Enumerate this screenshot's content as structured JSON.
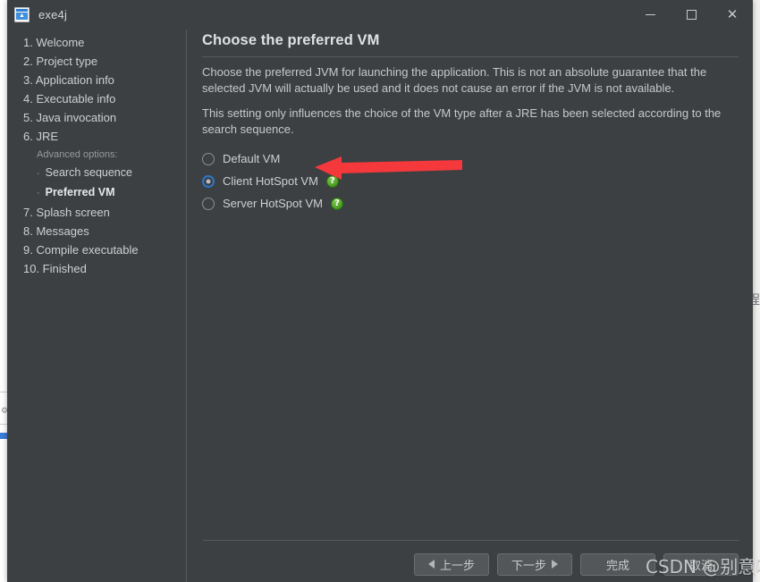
{
  "window": {
    "title": "exe4j",
    "icon": "exe4j-app-icon",
    "controls": {
      "minimize": "—",
      "maximize": "☐",
      "close": "✕"
    }
  },
  "sidebar": {
    "items": [
      {
        "label": "1. Welcome",
        "type": "step"
      },
      {
        "label": "2. Project type",
        "type": "step"
      },
      {
        "label": "3. Application info",
        "type": "step"
      },
      {
        "label": "4. Executable info",
        "type": "step"
      },
      {
        "label": "5. Java invocation",
        "type": "step"
      },
      {
        "label": "6. JRE",
        "type": "step"
      },
      {
        "label": "Advanced options:",
        "type": "subhead"
      },
      {
        "label": "Search sequence",
        "type": "sub",
        "bullet": "·",
        "active": false
      },
      {
        "label": "Preferred VM",
        "type": "sub",
        "bullet": "·",
        "active": true
      },
      {
        "label": "7. Splash screen",
        "type": "step"
      },
      {
        "label": "8. Messages",
        "type": "step"
      },
      {
        "label": "9. Compile executable",
        "type": "step"
      },
      {
        "label": "10. Finished",
        "type": "step"
      }
    ]
  },
  "content": {
    "title": "Choose the preferred VM",
    "paragraph1": "Choose the preferred JVM for launching the application. This is not an absolute guarantee that the selected JVM will actually be used and it does not cause an error if the JVM is not available.",
    "paragraph2": "This setting only influences the choice of the VM type after a JRE has been selected according to the search sequence.",
    "vm_options": [
      {
        "label": "Default VM",
        "selected": false,
        "help": false
      },
      {
        "label": "Client HotSpot VM",
        "selected": true,
        "help": true
      },
      {
        "label": "Server HotSpot VM",
        "selected": false,
        "help": true
      }
    ],
    "help_glyph": "?"
  },
  "footer": {
    "buttons": [
      {
        "label": "上一步",
        "icon": "triangle-left-icon",
        "icon_side": "left"
      },
      {
        "label": "下一步",
        "icon": "triangle-right-icon",
        "icon_side": "right"
      },
      {
        "label": "完成",
        "icon": null,
        "icon_side": null
      },
      {
        "label": "取消",
        "icon": null,
        "icon_side": null
      }
    ]
  },
  "overlay": {
    "watermark": "CSDN @别意喃i",
    "arrow_color": "#f5383b",
    "arrow_name": "red-annotation-arrow"
  },
  "background": {
    "right_partial_char": "程"
  },
  "colors": {
    "window_bg": "#3c4043",
    "text_primary": "#cfcfcf",
    "accent_radio": "#2e76c9",
    "help_green": "#53a62b",
    "annotation_red": "#f5383b"
  }
}
